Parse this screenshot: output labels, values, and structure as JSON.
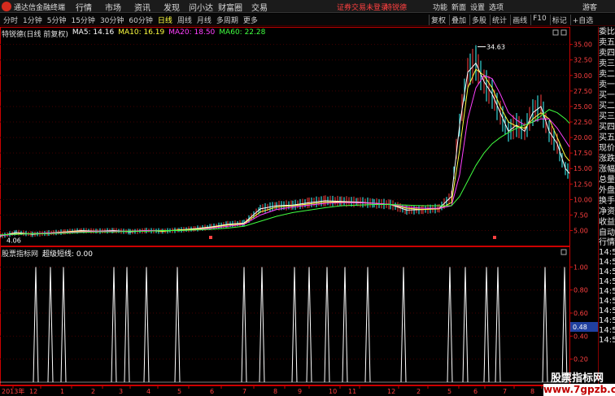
{
  "app": {
    "title": "通达信金融终端"
  },
  "menu": [
    "行情",
    "市场",
    "资讯",
    "发现",
    "问小达",
    "财富圈",
    "交易"
  ],
  "login_notice": "证券交易未登录",
  "stock_tag": "特锐德",
  "right_menu": [
    "功能",
    "新面",
    "设置",
    "选项"
  ],
  "guest": "游客",
  "periods": [
    {
      "label": "分时",
      "active": false
    },
    {
      "label": "1分钟",
      "active": false
    },
    {
      "label": "5分钟",
      "active": false
    },
    {
      "label": "15分钟",
      "active": false
    },
    {
      "label": "30分钟",
      "active": false
    },
    {
      "label": "60分钟",
      "active": false
    },
    {
      "label": "日线",
      "active": true
    },
    {
      "label": "周线",
      "active": false
    },
    {
      "label": "月线",
      "active": false
    },
    {
      "label": "多周期",
      "active": false
    },
    {
      "label": "更多",
      "active": false
    }
  ],
  "right_tools": [
    "复权",
    "叠加",
    "多股",
    "统计",
    "画线",
    "F10",
    "标记",
    "+自选"
  ],
  "chart_header": {
    "name": "特锐德(日线 前复权)",
    "ma": [
      {
        "label": "MA5: 14.16",
        "color": "#ffffff"
      },
      {
        "label": "MA10: 16.19",
        "color": "#ffff40"
      },
      {
        "label": "MA20: 18.50",
        "color": "#ff40ff"
      },
      {
        "label": "MA60: 22.28",
        "color": "#40ff40"
      }
    ]
  },
  "indicator_header": {
    "name": "股票指标网",
    "line": "超级短线: 0.00"
  },
  "annotations": {
    "peak": "34.63",
    "low": "4.06"
  },
  "colors": {
    "up": "#ff4040",
    "down": "#40ffff",
    "axis": "#cc0000",
    "grid": "#440000"
  },
  "quote_panel": {
    "top": [
      "委比",
      "卖五",
      "卖四",
      "卖三",
      "卖二",
      "卖一",
      "买一",
      "买二",
      "买三",
      "买四",
      "买五",
      "现价",
      "涨跌",
      "涨幅",
      "总量",
      "外盘",
      "换手",
      "净资",
      "收益"
    ],
    "bottom": [
      "自动",
      "行情",
      "14:5",
      "14:5",
      "14:5",
      "14:5",
      "14:5",
      "14:5",
      "14:5",
      "14:5",
      "14:5",
      "14:5"
    ]
  },
  "watermark": {
    "cn": "股票指标网",
    "url": "www.7gpzb.com"
  },
  "chart_data": [
    {
      "type": "line",
      "title": "",
      "xlabel": "",
      "ylabel": "",
      "ylim": [
        3.5,
        36
      ],
      "yticks": [
        "35.00",
        "32.50",
        "30.00",
        "27.50",
        "25.00",
        "22.50",
        "20.00",
        "17.50",
        "15.00",
        "12.50",
        "10.00",
        "7.50",
        "5.00"
      ],
      "ytick_values": [
        35,
        32.5,
        30,
        27.5,
        25,
        22.5,
        20,
        17.5,
        15,
        12.5,
        10,
        7.5,
        5
      ],
      "x": [
        0,
        20,
        40,
        60,
        80,
        100,
        120,
        140,
        160,
        180,
        200,
        220,
        240,
        260,
        280,
        300,
        320,
        340,
        360,
        380,
        400,
        420,
        440,
        460,
        480,
        500,
        520,
        540,
        555,
        565,
        575,
        585,
        595,
        605,
        615,
        625,
        635,
        645,
        655,
        665,
        675,
        685,
        695,
        700
      ],
      "series": [
        {
          "name": "MA5",
          "color": "#ffffff",
          "values": [
            4.1,
            4.7,
            4.4,
            4.6,
            4.8,
            5.0,
            4.9,
            5.0,
            4.8,
            5.0,
            4.9,
            5.1,
            5.3,
            5.6,
            6.0,
            6.2,
            8.5,
            9.0,
            9.1,
            9.5,
            9.8,
            9.7,
            9.6,
            9.4,
            9.2,
            8.3,
            8.4,
            8.6,
            10.5,
            22,
            30.5,
            32,
            29,
            27,
            24,
            21,
            22,
            21,
            24,
            25,
            21,
            19,
            15,
            14.2
          ]
        },
        {
          "name": "MA10",
          "color": "#ffff40",
          "values": [
            4.2,
            4.5,
            4.5,
            4.6,
            4.8,
            4.9,
            4.9,
            4.9,
            4.9,
            5.0,
            4.9,
            5.1,
            5.2,
            5.5,
            5.9,
            6.1,
            8.0,
            8.8,
            9.0,
            9.3,
            9.6,
            9.6,
            9.5,
            9.4,
            9.2,
            8.6,
            8.4,
            8.5,
            9.5,
            18,
            28,
            31,
            30,
            28,
            25,
            22.5,
            21.8,
            21.5,
            23,
            24,
            23,
            20,
            17,
            16.2
          ]
        },
        {
          "name": "MA20",
          "color": "#ff40ff",
          "values": [
            4.2,
            4.4,
            4.5,
            4.6,
            4.7,
            4.8,
            4.9,
            4.9,
            4.9,
            5.0,
            5.0,
            5.0,
            5.1,
            5.4,
            5.7,
            6.0,
            7.5,
            8.4,
            8.8,
            9.1,
            9.4,
            9.5,
            9.5,
            9.4,
            9.2,
            8.8,
            8.6,
            8.6,
            9.0,
            14,
            23,
            28,
            30,
            29.5,
            27,
            24,
            22.8,
            22,
            22.5,
            23,
            23,
            21.5,
            19.5,
            18.5
          ]
        },
        {
          "name": "MA60",
          "color": "#40ff40",
          "values": [
            4.3,
            4.4,
            4.5,
            4.5,
            4.6,
            4.7,
            4.8,
            4.8,
            4.9,
            4.9,
            5.0,
            5.0,
            5.1,
            5.2,
            5.4,
            5.7,
            6.5,
            7.3,
            7.9,
            8.3,
            8.7,
            9.0,
            9.1,
            9.2,
            9.2,
            9.1,
            9.0,
            9.0,
            9.0,
            10.5,
            13,
            15.5,
            17.5,
            19,
            20,
            20.8,
            21.5,
            22,
            22.5,
            23.5,
            24.5,
            24,
            23,
            22.3
          ]
        }
      ]
    },
    {
      "type": "bar",
      "title": "",
      "ylim": [
        0,
        1.08
      ],
      "yticks": [
        "1.00",
        "0.80",
        "0.60",
        "0.40",
        "0.20"
      ],
      "ytick_values": [
        1,
        0.8,
        0.6,
        0.4,
        0.2
      ],
      "current": "0.48",
      "current_value": 0.48,
      "x": [
        44,
        62,
        78,
        140,
        156,
        180,
        218,
        300,
        322,
        362,
        380,
        402,
        424,
        452,
        496,
        553,
        572,
        598,
        612,
        670,
        694
      ],
      "values": [
        1,
        1,
        1,
        1,
        1,
        1,
        1,
        1,
        1,
        1,
        1,
        1,
        1,
        1,
        1,
        1,
        1,
        1,
        1,
        1,
        1
      ]
    }
  ],
  "date_axis": [
    {
      "label": "2013年",
      "x": 2
    },
    {
      "label": "12",
      "x": 36
    },
    {
      "label": "1",
      "x": 74
    },
    {
      "label": "2",
      "x": 112
    },
    {
      "label": "3",
      "x": 146
    },
    {
      "label": "4",
      "x": 180
    },
    {
      "label": "5",
      "x": 218
    },
    {
      "label": "6",
      "x": 258
    },
    {
      "label": "7",
      "x": 298
    },
    {
      "label": "8",
      "x": 336
    },
    {
      "label": "9",
      "x": 366
    },
    {
      "label": "10",
      "x": 404
    },
    {
      "label": "11",
      "x": 428
    },
    {
      "label": "12",
      "x": 476
    },
    {
      "label": "2",
      "x": 512
    },
    {
      "label": "5",
      "x": 550
    },
    {
      "label": "6",
      "x": 582
    },
    {
      "label": "7",
      "x": 618
    },
    {
      "label": "8",
      "x": 652
    }
  ]
}
